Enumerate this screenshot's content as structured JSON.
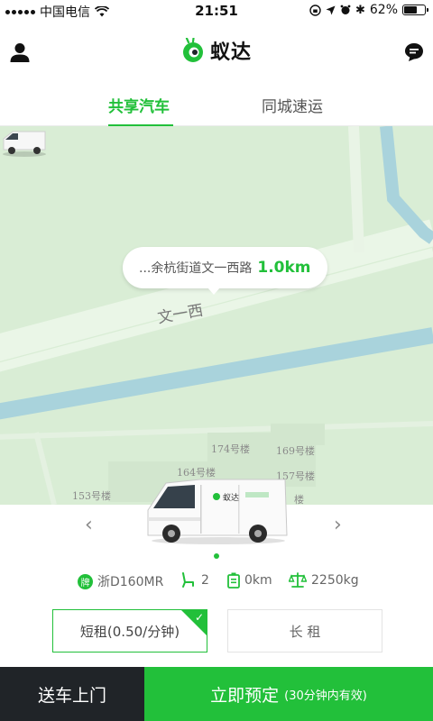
{
  "status_bar": {
    "carrier": "中国电信",
    "time": "21:51",
    "battery": "62%",
    "battery_level": 0.62
  },
  "header": {
    "brand_name": "蚁达",
    "left_icon": "user-icon",
    "right_icon": "message-icon"
  },
  "tabs": [
    {
      "label": "共享汽车",
      "active": true
    },
    {
      "label": "同城速运",
      "active": false
    }
  ],
  "map": {
    "callout_address": "...余杭街道文一西路",
    "callout_distance": "1.0km",
    "road_label": "文一西",
    "building_labels": [
      "174号楼",
      "169号楼",
      "164号楼",
      "157号楼",
      "153号楼",
      "楼"
    ]
  },
  "vehicle": {
    "plate": "浙D160MR",
    "plate_badge": "牌",
    "seats": "2",
    "range": "0km",
    "load": "2250kg",
    "brand_on_van": "蚁达"
  },
  "rental_options": {
    "short": "短租(0.50/分钟)",
    "long": "长 租"
  },
  "bottom": {
    "deliver": "送车上门",
    "book": "立即预定",
    "book_note": "(30分钟内有效)"
  },
  "colors": {
    "accent": "#22c03a",
    "dark_button": "#202428",
    "map_bg": "#d9edd5",
    "water": "#a9d3dc"
  }
}
